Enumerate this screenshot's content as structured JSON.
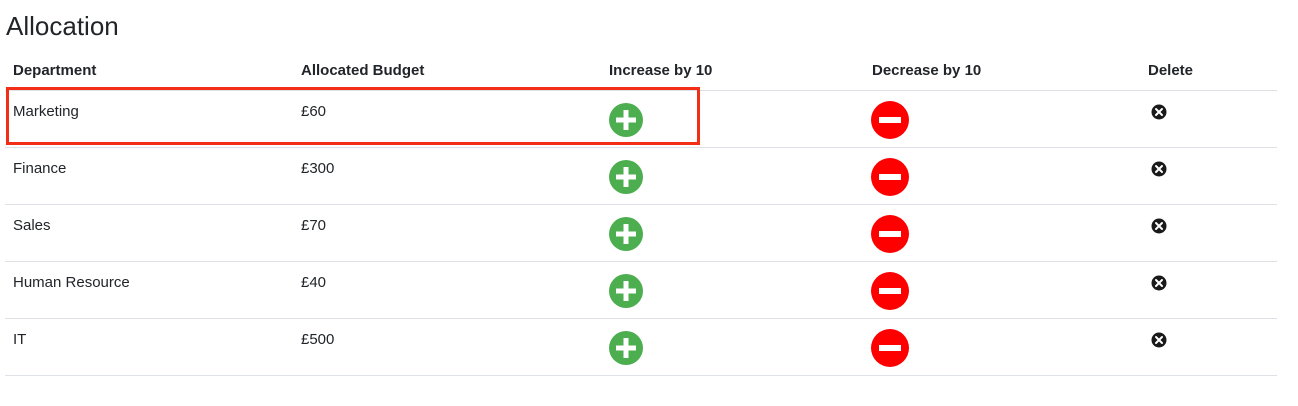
{
  "page": {
    "title": "Allocation"
  },
  "table": {
    "headers": {
      "department": "Department",
      "budget": "Allocated Budget",
      "increase": "Increase by 10",
      "decrease": "Decrease by 10",
      "delete": "Delete"
    },
    "rows": [
      {
        "department": "Marketing",
        "budget": "£60"
      },
      {
        "department": "Finance",
        "budget": "£300"
      },
      {
        "department": "Sales",
        "budget": "£70"
      },
      {
        "department": "Human Resource",
        "budget": "£40"
      },
      {
        "department": "IT",
        "budget": "£500"
      }
    ]
  },
  "icons": {
    "increase": "plus-circle-icon",
    "decrease": "minus-circle-icon",
    "delete": "x-circle-icon"
  },
  "colors": {
    "increase": "#4cae4f",
    "decrease": "#ff0000",
    "delete": "#1a1a1a",
    "highlight": "#f22e16"
  }
}
